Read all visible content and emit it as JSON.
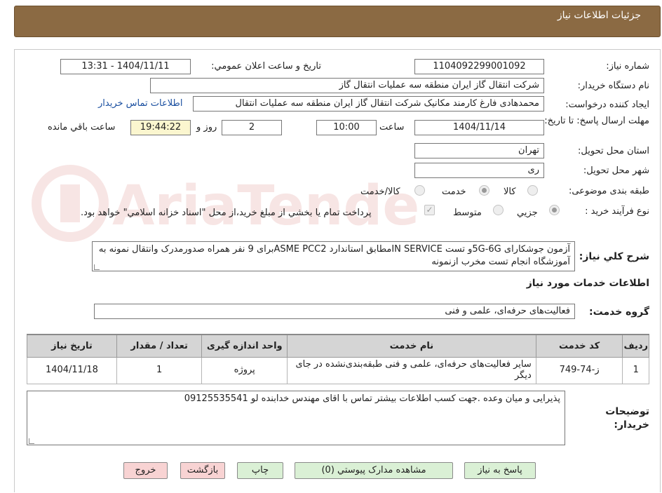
{
  "header": {
    "title": "جزئیات اطلاعات نیاز"
  },
  "fields": {
    "need_number_label": "شماره نیاز:",
    "need_number": "1104092299001092",
    "announce_label": "تاریخ و ساعت اعلان عمومي:",
    "announce_value": "1404/11/11 - 13:31",
    "buyer_org_label": "نام دستگاه خريدار:",
    "buyer_org": "شرکت انتقال گاز ایران منطقه سه عملیات انتقال گاز",
    "requester_label": "ايجاد کننده درخواست:",
    "requester": "محمدهادی فارغ کارمند مکانیک شرکت انتقال گاز ایران منطقه سه عملیات انتقال",
    "buyer_contact_link": "اطلاعات تماس خريدار",
    "deadline_label": "مهلت ارسال پاسخ: تا تاریخ:",
    "deadline_date": "1404/11/14",
    "time_label": "ساعت",
    "deadline_time": "10:00",
    "days_value": "2",
    "days_label": "روز و",
    "remaining_time": "19:44:22",
    "remaining_label": "ساعت باقي مانده",
    "province_label": "استان محل تحويل:",
    "province": "تهران",
    "city_label": "شهر محل تحويل:",
    "city": "ری",
    "category_label": "طبقه بندی موضوعی:",
    "category_options": [
      "کالا",
      "خدمت",
      "کالا/خدمت"
    ],
    "process_label": "نوع فرآیند خرید :",
    "process_options": [
      "جزيي",
      "متوسط"
    ],
    "payment_note": "پرداخت تمام يا بخشي از مبلغ خريد،از محل \"اسناد خزانه اسلامي\" خواهد بود."
  },
  "description": {
    "label": "شرح کلي نياز:",
    "text": "آزمون جوشکارای 5G-6Gو تست IN SERVICEمطابق استاندارد ASME PCC2برای 9 نفر همراه صدورمدرک وانتقال نمونه به آموزشگاه انجام تست مخرب ازنمونه"
  },
  "services": {
    "title": "اطلاعات خدمات مورد نياز",
    "group_label": "گروه خدمت:",
    "group_value": "فعالیت‌های حرفه‌ای، علمی و فنی",
    "columns": [
      "رديف",
      "کد خدمت",
      "نام خدمت",
      "واحد اندازه گيری",
      "تعداد / مقدار",
      "تاريخ نياز"
    ],
    "rows": [
      {
        "index": "1",
        "code": "ز-74-749",
        "name": "سایر فعالیت‌های حرفه‌ای، علمی و فنی طبقه‌بندی‌نشده در جای دیگر",
        "unit": "پروژه",
        "quantity": "1",
        "date": "1404/11/18"
      }
    ]
  },
  "buyer_notes": {
    "label": "توضيحات خريدار:",
    "text": "پذیرایی و میان وعده .جهت کسب اطلاعات بیشتر تماس با اقای مهندس خدابنده لو 09125535541"
  },
  "buttons": {
    "reply": "پاسخ به نياز",
    "attachments": "مشاهده مدارک پيوستي (0)",
    "print": "چاپ",
    "back": "بازگشت",
    "exit": "خروج"
  },
  "watermark": {
    "text": "AriaTender.neT"
  }
}
